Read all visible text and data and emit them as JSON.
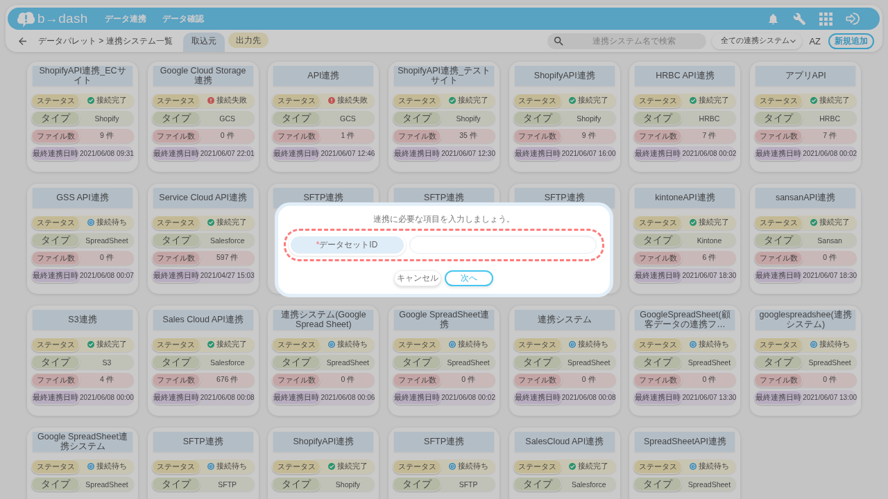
{
  "header": {
    "logo": "b→dash",
    "nav": [
      {
        "label": "データ連携"
      },
      {
        "label": "データ確認"
      }
    ]
  },
  "toolbar": {
    "breadcrumb": "データパレット > 連携システム一覧",
    "tabs": [
      {
        "label": "取込元",
        "selected": true
      },
      {
        "label": "出力先",
        "selected": false
      }
    ],
    "search": {
      "placeholder": "連携システム名で検索"
    },
    "filter": {
      "value": "全ての連携システム"
    },
    "sort": {
      "label": "AZ"
    },
    "add_button": {
      "label": "新規追加"
    }
  },
  "cards": [
    {
      "title": "ShopifyAPI連携_ECサイト",
      "fields": [
        {
          "kind": "connected",
          "label": "ステータス",
          "value": "接続完了"
        },
        {
          "kind": "type",
          "label": "タイプ",
          "value": "Shopify"
        },
        {
          "kind": "files",
          "label": "ファイル数",
          "value": "9 件"
        },
        {
          "kind": "date",
          "label": "最終連携日時",
          "value": "2021/06/08 09:31"
        }
      ]
    },
    {
      "title": "Google Cloud Storage 連携",
      "fields": [
        {
          "kind": "failed",
          "label": "ステータス",
          "value": "接続失敗"
        },
        {
          "kind": "type",
          "label": "タイプ",
          "value": "GCS"
        },
        {
          "kind": "files",
          "label": "ファイル数",
          "value": "0 件"
        },
        {
          "kind": "date",
          "label": "最終連携日時",
          "value": "2021/06/07 22:01"
        }
      ]
    },
    {
      "title": "API連携",
      "fields": [
        {
          "kind": "failed",
          "label": "ステータス",
          "value": "接続失敗"
        },
        {
          "kind": "type",
          "label": "タイプ",
          "value": "GCS"
        },
        {
          "kind": "files",
          "label": "ファイル数",
          "value": "1 件"
        },
        {
          "kind": "date",
          "label": "最終連携日時",
          "value": "2021/06/07 12:46"
        }
      ]
    },
    {
      "title": "ShopifyAPI連携_テストサイト",
      "fields": [
        {
          "kind": "connected",
          "label": "ステータス",
          "value": "接続完了"
        },
        {
          "kind": "type",
          "label": "タイプ",
          "value": "Shopify"
        },
        {
          "kind": "files",
          "label": "ファイル数",
          "value": "35 件"
        },
        {
          "kind": "date",
          "label": "最終連携日時",
          "value": "2021/06/07 12:30"
        }
      ]
    },
    {
      "title": "ShopifyAPI連携",
      "fields": [
        {
          "kind": "connected",
          "label": "ステータス",
          "value": "接続完了"
        },
        {
          "kind": "type",
          "label": "タイプ",
          "value": "Shopify"
        },
        {
          "kind": "files",
          "label": "ファイル数",
          "value": "9 件"
        },
        {
          "kind": "date",
          "label": "最終連携日時",
          "value": "2021/06/07 16:00"
        }
      ]
    },
    {
      "title": "HRBC API連携",
      "fields": [
        {
          "kind": "connected",
          "label": "ステータス",
          "value": "接続完了"
        },
        {
          "kind": "type",
          "label": "タイプ",
          "value": "HRBC"
        },
        {
          "kind": "files",
          "label": "ファイル数",
          "value": "7 件"
        },
        {
          "kind": "date",
          "label": "最終連携日時",
          "value": "2021/06/08 00:02"
        }
      ]
    },
    {
      "title": "アプリAPI",
      "fields": [
        {
          "kind": "connected",
          "label": "ステータス",
          "value": "接続完了"
        },
        {
          "kind": "type",
          "label": "タイプ",
          "value": "HRBC"
        },
        {
          "kind": "files",
          "label": "ファイル数",
          "value": "7 件"
        },
        {
          "kind": "date",
          "label": "最終連携日時",
          "value": "2021/06/08 00:02"
        }
      ]
    },
    {
      "title": "GSS API連携",
      "fields": [
        {
          "kind": "waiting",
          "label": "ステータス",
          "value": "接続待ち"
        },
        {
          "kind": "type",
          "label": "タイプ",
          "value": "SpreadSheet"
        },
        {
          "kind": "files",
          "label": "ファイル数",
          "value": "0 件"
        },
        {
          "kind": "date",
          "label": "最終連携日時",
          "value": "2021/06/08 00:07"
        }
      ]
    },
    {
      "title": "Service Cloud API連携",
      "fields": [
        {
          "kind": "connected",
          "label": "ステータス",
          "value": "接続完了"
        },
        {
          "kind": "type",
          "label": "タイプ",
          "value": "Salesforce"
        },
        {
          "kind": "files",
          "label": "ファイル数",
          "value": "597 件"
        },
        {
          "kind": "date",
          "label": "最終連携日時",
          "value": "2021/04/27 15:03"
        }
      ]
    },
    {
      "title": "SFTP連携"
    },
    {
      "title": "SFTP連携"
    },
    {
      "title": "SFTP連携"
    },
    {
      "title": "kintoneAPI連携",
      "fields": [
        {
          "kind": "connected",
          "label": "ステータス",
          "value": "接続完了"
        },
        {
          "kind": "type",
          "label": "タイプ",
          "value": "Kintone"
        },
        {
          "kind": "files",
          "label": "ファイル数",
          "value": "6 件"
        },
        {
          "kind": "date",
          "label": "最終連携日時",
          "value": "2021/06/07 18:30"
        }
      ]
    },
    {
      "title": "sansanAPI連携",
      "fields": [
        {
          "kind": "connected",
          "label": "ステータス",
          "value": "接続完了"
        },
        {
          "kind": "type",
          "label": "タイプ",
          "value": "Sansan"
        },
        {
          "kind": "files",
          "label": "ファイル数",
          "value": "0 件"
        },
        {
          "kind": "date",
          "label": "最終連携日時",
          "value": "2021/06/07 18:30"
        }
      ]
    },
    {
      "title": "S3連携",
      "fields": [
        {
          "kind": "connected",
          "label": "ステータス",
          "value": "接続完了"
        },
        {
          "kind": "type",
          "label": "タイプ",
          "value": "S3"
        },
        {
          "kind": "files",
          "label": "ファイル数",
          "value": "4 件"
        },
        {
          "kind": "date",
          "label": "最終連携日時",
          "value": "2021/06/08 00:00"
        }
      ]
    },
    {
      "title": "Sales Cloud API連携",
      "fields": [
        {
          "kind": "connected",
          "label": "ステータス",
          "value": "接続完了"
        },
        {
          "kind": "type",
          "label": "タイプ",
          "value": "Salesforce"
        },
        {
          "kind": "files",
          "label": "ファイル数",
          "value": "676 件"
        },
        {
          "kind": "date",
          "label": "最終連携日時",
          "value": "2021/06/08 00:08"
        }
      ]
    },
    {
      "title": "連携システム(Google Spread Sheet)",
      "fields": [
        {
          "kind": "waiting",
          "label": "ステータス",
          "value": "接続待ち"
        },
        {
          "kind": "type",
          "label": "タイプ",
          "value": "SpreadSheet"
        },
        {
          "kind": "files",
          "label": "ファイル数",
          "value": "0 件"
        },
        {
          "kind": "date",
          "label": "最終連携日時",
          "value": "2021/06/08 00:06"
        }
      ]
    },
    {
      "title": "Google SpreadSheet連携",
      "fields": [
        {
          "kind": "waiting",
          "label": "ステータス",
          "value": "接続待ち"
        },
        {
          "kind": "type",
          "label": "タイプ",
          "value": "SpreadSheet"
        },
        {
          "kind": "files",
          "label": "ファイル数",
          "value": "0 件"
        },
        {
          "kind": "date",
          "label": "最終連携日時",
          "value": "2021/06/08 00:02"
        }
      ]
    },
    {
      "title": "連携システム",
      "fields": [
        {
          "kind": "waiting",
          "label": "ステータス",
          "value": "接続待ち"
        },
        {
          "kind": "type",
          "label": "タイプ",
          "value": "SpreadSheet"
        },
        {
          "kind": "files",
          "label": "ファイル数",
          "value": "0 件"
        },
        {
          "kind": "date",
          "label": "最終連携日時",
          "value": "2021/06/08 00:08"
        }
      ]
    },
    {
      "title": "GoogleSpreadSheet(顧客データの連携フ…",
      "fields": [
        {
          "kind": "waiting",
          "label": "ステータス",
          "value": "接続待ち"
        },
        {
          "kind": "type",
          "label": "タイプ",
          "value": "SpreadSheet"
        },
        {
          "kind": "files",
          "label": "ファイル数",
          "value": "0 件"
        },
        {
          "kind": "date",
          "label": "最終連携日時",
          "value": "2021/06/07 13:30"
        }
      ]
    },
    {
      "title": "googlespreadshee(連携システム)",
      "fields": [
        {
          "kind": "waiting",
          "label": "ステータス",
          "value": "接続待ち"
        },
        {
          "kind": "type",
          "label": "タイプ",
          "value": "SpreadSheet"
        },
        {
          "kind": "files",
          "label": "ファイル数",
          "value": "0 件"
        },
        {
          "kind": "date",
          "label": "最終連携日時",
          "value": "2021/06/07 13:00"
        }
      ]
    },
    {
      "title": "Google SpreadSheet連携システム",
      "fields": [
        {
          "kind": "waiting",
          "label": "ステータス",
          "value": "接続待ち"
        },
        {
          "kind": "type",
          "label": "タイプ",
          "value": "SpreadSheet"
        }
      ]
    },
    {
      "title": "SFTP連携",
      "fields": [
        {
          "kind": "waiting",
          "label": "ステータス",
          "value": "接続待ち"
        },
        {
          "kind": "type",
          "label": "タイプ",
          "value": "SFTP"
        }
      ]
    },
    {
      "title": "ShopifyAPI連携",
      "fields": [
        {
          "kind": "connected",
          "label": "ステータス",
          "value": "接続完了"
        },
        {
          "kind": "type",
          "label": "タイプ",
          "value": "Shopify"
        }
      ]
    },
    {
      "title": "SFTP連携",
      "fields": [
        {
          "kind": "waiting",
          "label": "ステータス",
          "value": "接続待ち"
        },
        {
          "kind": "type",
          "label": "タイプ",
          "value": "SFTP"
        }
      ]
    },
    {
      "title": "SalesCloud API連携",
      "fields": [
        {
          "kind": "connected",
          "label": "ステータス",
          "value": "接続完了"
        },
        {
          "kind": "type",
          "label": "タイプ",
          "value": "Salesforce"
        }
      ]
    },
    {
      "title": "SpreadSheetAPI連携",
      "fields": [
        {
          "kind": "waiting",
          "label": "ステータス",
          "value": "接続待ち"
        },
        {
          "kind": "type",
          "label": "タイプ",
          "value": "SpreadSheet"
        }
      ]
    }
  ],
  "dialog": {
    "message": "連携に必要な項目を入力しましょう。",
    "field": {
      "required_mark": "*",
      "label": "データセットID",
      "highlighted": true
    },
    "buttons": [
      {
        "label": "キャンセル",
        "kind": "cancel"
      },
      {
        "label": "次へ",
        "kind": "primary"
      }
    ]
  }
}
